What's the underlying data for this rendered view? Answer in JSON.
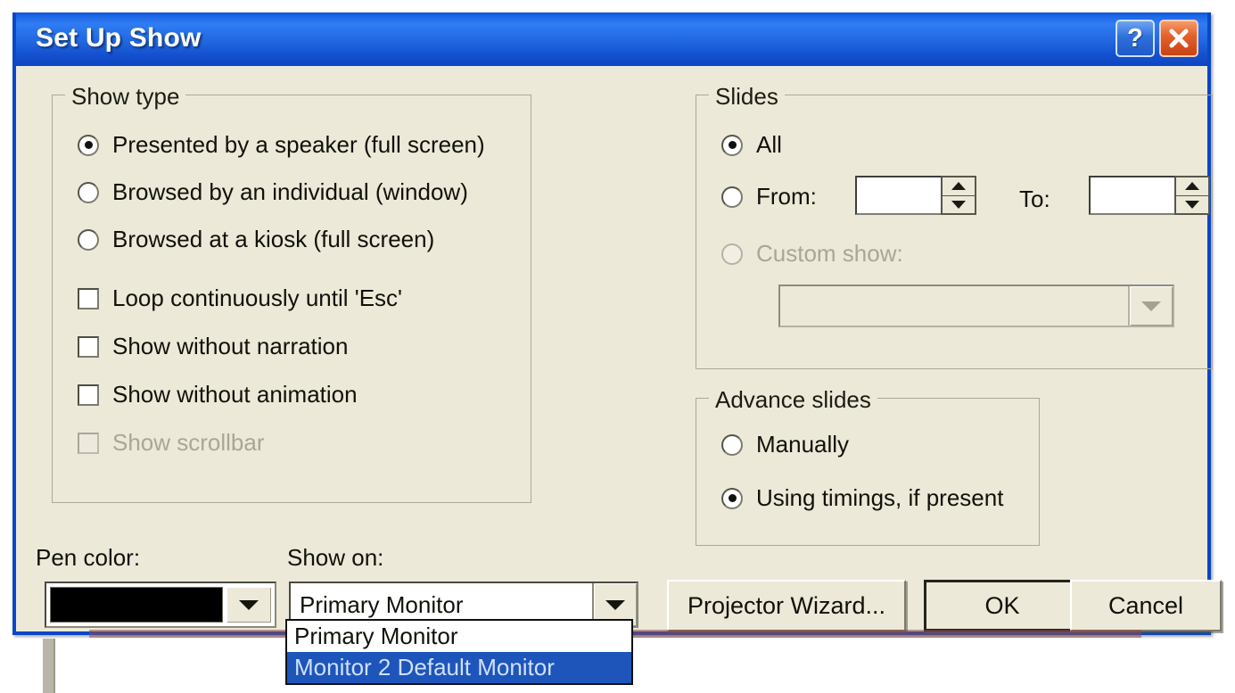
{
  "window": {
    "title": "Set Up Show",
    "help_button": "?",
    "close_button": "X",
    "accent_titlebar": "#1f68e8",
    "background": "#ece9d8"
  },
  "show_type": {
    "legend": "Show type",
    "radios": [
      {
        "label": "Presented by a speaker (full screen)",
        "checked": true,
        "disabled": false
      },
      {
        "label": "Browsed by an individual (window)",
        "checked": false,
        "disabled": false
      },
      {
        "label": "Browsed at a kiosk (full screen)",
        "checked": false,
        "disabled": false
      }
    ],
    "checkboxes": [
      {
        "label": "Loop continuously until 'Esc'",
        "checked": false,
        "disabled": false
      },
      {
        "label": "Show without narration",
        "checked": false,
        "disabled": false
      },
      {
        "label": "Show without animation",
        "checked": false,
        "disabled": false
      },
      {
        "label": "Show scrollbar",
        "checked": false,
        "disabled": true
      }
    ]
  },
  "slides": {
    "legend": "Slides",
    "radio_all": "All",
    "radio_from": "From:",
    "label_to": "To:",
    "from_value": "",
    "to_value": "",
    "radio_custom": "Custom show:",
    "custom_show_value": "",
    "all_checked": true,
    "from_checked": false,
    "custom_checked": false,
    "custom_disabled": true
  },
  "advance_slides": {
    "legend": "Advance slides",
    "radios": [
      {
        "label": "Manually",
        "checked": false
      },
      {
        "label": "Using timings, if present",
        "checked": true
      }
    ]
  },
  "pen_color": {
    "label": "Pen color:",
    "value": "#000000"
  },
  "show_on": {
    "label": "Show on:",
    "selected": "Primary Monitor",
    "options": [
      {
        "label": "Primary Monitor",
        "selected": false
      },
      {
        "label": "Monitor  2 Default Monitor",
        "selected": true
      }
    ],
    "highlight_color": "#1d55bb"
  },
  "buttons": {
    "projector_wizard": "Projector Wizard...",
    "ok": "OK",
    "cancel": "Cancel"
  }
}
